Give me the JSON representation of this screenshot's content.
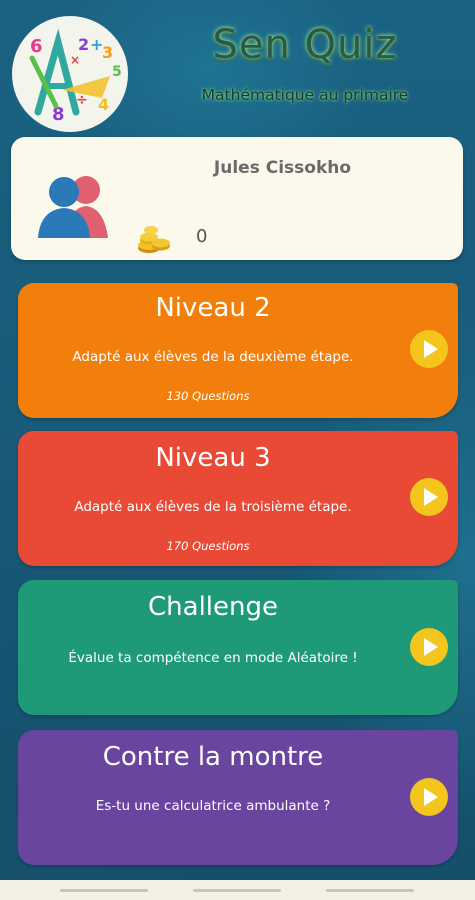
{
  "header": {
    "title": "Sen Quiz",
    "subtitle": "Mathématique au primaire"
  },
  "profile": {
    "username": "Jules Cissokho",
    "coins": "0",
    "avatar_icon": "users-icon",
    "coins_icon": "coins-icon"
  },
  "levels": [
    {
      "title": "Niveau 2",
      "description": "Adapté aux élèves de la deuxième étape.",
      "questions": "130 Questions",
      "color": "#f27f0c"
    },
    {
      "title": "Niveau 3",
      "description": "Adapté aux élèves de la troisième étape.",
      "questions": "170 Questions",
      "color": "#e84a35"
    },
    {
      "title": "Challenge",
      "description": "Évalue ta compétence en mode Aléatoire !",
      "color": "#1f9a78"
    },
    {
      "title": "Contre la montre",
      "description": "Es-tu une calculatrice ambulante ?",
      "color": "#6a45a0"
    }
  ],
  "play_icon": "play-icon",
  "accent": "#f4c51d"
}
